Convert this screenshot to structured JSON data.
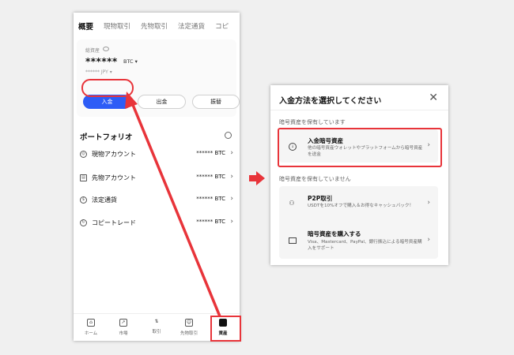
{
  "left_screen": {
    "tabs": [
      "概要",
      "現物取引",
      "先物取引",
      "法定通貨",
      "コピ"
    ],
    "asset_card": {
      "label": "総資産",
      "balance": "******",
      "unit": "BTC ▾",
      "sub_balance": "****** JPY ▾",
      "buttons": {
        "deposit": "入金",
        "withdraw": "出金",
        "transfer": "振替"
      }
    },
    "portfolio": {
      "title": "ポートフォリオ",
      "rows": [
        {
          "label": "現物アカウント",
          "value": "****** BTC"
        },
        {
          "label": "先物アカウント",
          "value": "****** BTC"
        },
        {
          "label": "法定通貨",
          "value": "****** BTC"
        },
        {
          "label": "コピートレード",
          "value": "****** BTC"
        }
      ]
    },
    "bottom_nav": [
      {
        "label": "ホーム",
        "icon": "home-icon"
      },
      {
        "label": "市場",
        "icon": "market-icon"
      },
      {
        "label": "取引",
        "icon": "trade-icon"
      },
      {
        "label": "先物取引",
        "icon": "futures-icon"
      },
      {
        "label": "資産",
        "icon": "assets-icon"
      }
    ]
  },
  "right_screen": {
    "title": "入金方法を選択してください",
    "close_label": "✕",
    "section1": "暗号資産を保有しています",
    "option_deposit": {
      "title": "入金暗号資産",
      "desc": "他の暗号資産ウォレットやプラットフォームから暗号資産を送金"
    },
    "section2": "暗号資産を保有していません",
    "option_p2p": {
      "title": "P2P取引",
      "desc": "USDTを10%オフで購入＆お得なキャッシュバック！"
    },
    "option_buy": {
      "title": "暗号資産を購入する",
      "desc": "Visa、Mastercard、PayPal、銀行振込による暗号資産購入をサポート"
    }
  },
  "colors": {
    "accent_blue": "#2d5cf6",
    "highlight_red": "#e8343a"
  }
}
